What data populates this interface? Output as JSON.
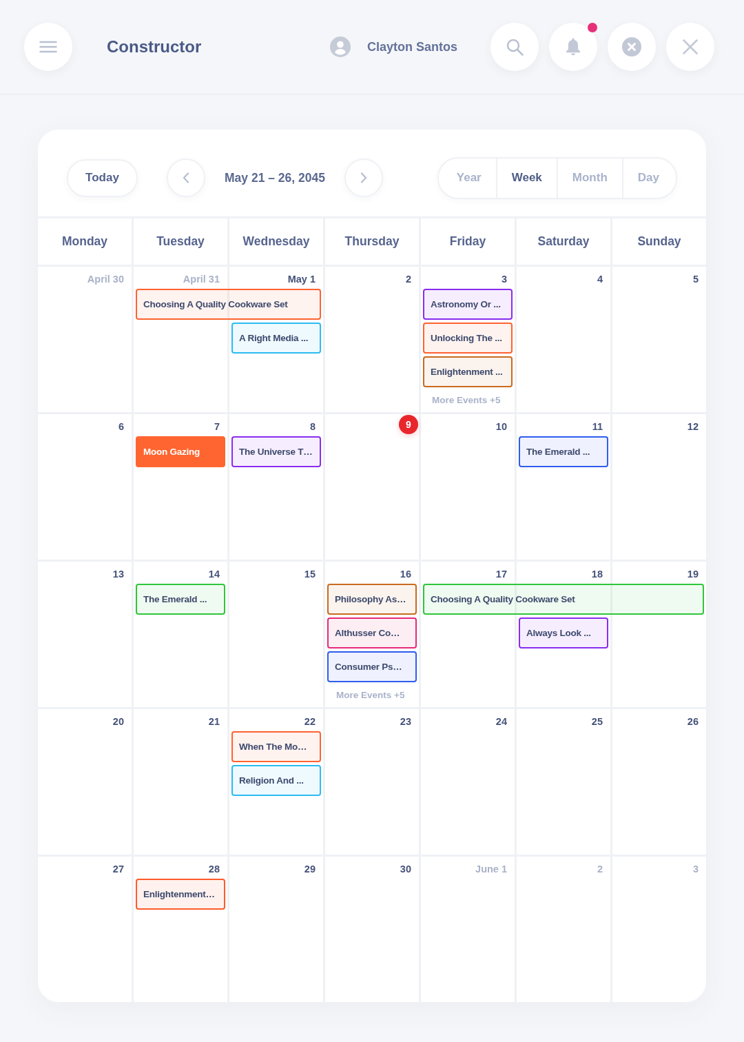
{
  "header": {
    "title": "Constructor",
    "user": {
      "name": "Clayton Santos"
    },
    "notifications": {
      "unread": true
    }
  },
  "toolbar": {
    "today_button": "Today",
    "range": "May 21 – 26, 2045",
    "views": [
      {
        "label": "Year",
        "selected": false
      },
      {
        "label": "Week",
        "selected": true
      },
      {
        "label": "Month",
        "selected": false
      },
      {
        "label": "Day",
        "selected": false
      }
    ]
  },
  "calendar": {
    "weekdays": [
      "Monday",
      "Tuesday",
      "Wednesday",
      "Thursday",
      "Friday",
      "Saturday",
      "Sunday"
    ],
    "weeks": [
      {
        "days": [
          {
            "label": "April 30",
            "outside_month": true,
            "today": false
          },
          {
            "label": "April 31",
            "outside_month": true,
            "today": false,
            "events": [
              {
                "title": "Choosing A Quality Cookware Set",
                "color": "#ff6230",
                "kind": "outline"
              }
            ]
          },
          {
            "label": "May 1",
            "outside_month": false,
            "today": false,
            "events": [
              {
                "kind": "continued"
              },
              {
                "title": "A Right Media ...",
                "color": "#2bbcf2",
                "kind": "outline"
              }
            ]
          },
          {
            "label": "2",
            "outside_month": false,
            "today": false
          },
          {
            "label": "3",
            "outside_month": false,
            "today": false,
            "events": [
              {
                "title": "Astronomy Or ...",
                "color": "#8a2cf0",
                "kind": "outline"
              },
              {
                "title": "Unlocking The ...",
                "color": "#ff6230",
                "kind": "outline"
              },
              {
                "title": "Enlightenment ...",
                "color": "#c96a1e",
                "kind": "outline"
              }
            ],
            "more_events": "More Events +5"
          },
          {
            "label": "4",
            "outside_month": false,
            "today": false
          },
          {
            "label": "5",
            "outside_month": false,
            "today": false
          }
        ]
      },
      {
        "days": [
          {
            "label": "6",
            "outside_month": false,
            "today": false
          },
          {
            "label": "7",
            "outside_month": false,
            "today": false,
            "events": [
              {
                "title": "Moon Gazing",
                "color": "#ff6530",
                "kind": "filled"
              }
            ]
          },
          {
            "label": "8",
            "outside_month": false,
            "today": false,
            "events": [
              {
                "title": "The Universe T…",
                "color": "#8a2cf0",
                "kind": "outline"
              }
            ]
          },
          {
            "label": "9",
            "outside_month": false,
            "today": true
          },
          {
            "label": "10",
            "outside_month": false,
            "today": false
          },
          {
            "label": "11",
            "outside_month": false,
            "today": false,
            "events": [
              {
                "title": "The Emerald ...",
                "color": "#2f5cf0",
                "kind": "outline"
              }
            ]
          },
          {
            "label": "12",
            "outside_month": false,
            "today": false
          }
        ]
      },
      {
        "days": [
          {
            "label": "13",
            "outside_month": false,
            "today": false
          },
          {
            "label": "14",
            "outside_month": false,
            "today": false,
            "events": [
              {
                "title": "The Emerald ...",
                "color": "#2ec63a",
                "kind": "outline"
              }
            ]
          },
          {
            "label": "15",
            "outside_month": false,
            "today": false
          },
          {
            "label": "16",
            "outside_month": false,
            "today": false,
            "events": [
              {
                "title": "Philosophy As…",
                "color": "#c96a1e",
                "kind": "outline"
              },
              {
                "title": "Althusser Co…",
                "color": "#e52a78",
                "kind": "outline"
              },
              {
                "title": "Consumer Ps…",
                "color": "#2f5cf0",
                "kind": "outline"
              }
            ],
            "more_events": "More Events +5"
          },
          {
            "label": "17",
            "outside_month": false,
            "today": false,
            "events": [
              {
                "title": "Choosing A Quality Cookware Set",
                "color": "#2ec63a",
                "kind": "outline"
              }
            ]
          },
          {
            "label": "18",
            "outside_month": false,
            "today": false,
            "events": [
              {
                "kind": "continued"
              },
              {
                "title": "Always Look ...",
                "color": "#8a2cf0",
                "kind": "outline"
              }
            ]
          },
          {
            "label": "19",
            "outside_month": false,
            "today": false,
            "events": [
              {
                "kind": "continued"
              }
            ]
          }
        ]
      },
      {
        "days": [
          {
            "label": "20",
            "outside_month": false,
            "today": false
          },
          {
            "label": "21",
            "outside_month": false,
            "today": false
          },
          {
            "label": "22",
            "outside_month": false,
            "today": false,
            "events": [
              {
                "title": "When The Mo…",
                "color": "#ff6230",
                "kind": "outline"
              },
              {
                "title": "Religion And ...",
                "color": "#2bbcf2",
                "kind": "outline"
              }
            ]
          },
          {
            "label": "23",
            "outside_month": false,
            "today": false
          },
          {
            "label": "24",
            "outside_month": false,
            "today": false
          },
          {
            "label": "25",
            "outside_month": false,
            "today": false
          },
          {
            "label": "26",
            "outside_month": false,
            "today": false
          }
        ]
      },
      {
        "days": [
          {
            "label": "27",
            "outside_month": false,
            "today": false
          },
          {
            "label": "28",
            "outside_month": false,
            "today": false,
            "events": [
              {
                "title": "Enlightenment…",
                "color": "#ff5a2a",
                "kind": "outline"
              }
            ]
          },
          {
            "label": "29",
            "outside_month": false,
            "today": false
          },
          {
            "label": "30",
            "outside_month": false,
            "today": false
          },
          {
            "label": "June 1",
            "outside_month": true,
            "today": false
          },
          {
            "label": "2",
            "outside_month": true,
            "today": false
          },
          {
            "label": "3",
            "outside_month": true,
            "today": false
          }
        ]
      }
    ]
  }
}
